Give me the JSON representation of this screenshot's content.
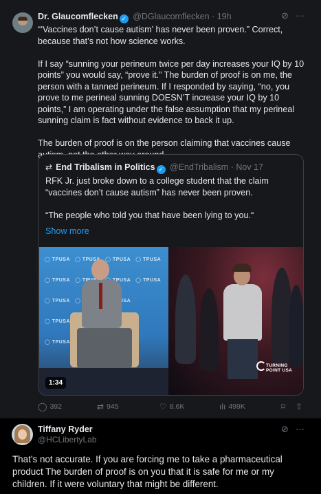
{
  "tweet": {
    "author_name": "Dr. Glaucomflecken",
    "author_handle": "@DGlaucomflecken",
    "time": "19h",
    "text": "“‘Vaccines don’t cause autism’ has never been proven.” Correct, because that’s not how science works.\n\nIf I say “sunning your perineum twice per day increases your IQ by 10 points” you would say, “prove it.” The burden of proof is on me, the person with a tanned perineum. If I responded by saying, “no, you prove to me perineal sunning DOESN’T increase your IQ by 10 points,” I am operating under the false assumption that my perineal sunning claim is fact without evidence to back it up.\n\nThe burden of proof is on the person claiming that vaccines cause autism, not the other way around.",
    "quoted": {
      "author_name": "End Tribalism in Politics",
      "author_handle": "@EndTribalism",
      "date": "Nov 17",
      "text": "RFK Jr. just broke down to a college student that the claim “vaccines don’t cause autism” has never been proven.\n\n“The people who told you that have been lying to you.“\n…",
      "show_more": "Show more",
      "video_duration": "1:34",
      "watermark": "TURNING POINT USA"
    },
    "stats": {
      "replies": "392",
      "reposts": "945",
      "likes": "8.6K",
      "views": "499K"
    }
  },
  "reply": {
    "author_name": "Tiffany Ryder",
    "author_handle": "@HCLibertyLab",
    "text": "That’s not accurate. If you are forcing me to take a pharmaceutical product The burden of proof is on you that it is safe for me or my children. If it were voluntary that might be different."
  },
  "icons": {
    "verified": "verified-badge-icon",
    "grok": "grok-icon",
    "more": "more-icon",
    "reply": "reply-icon",
    "repost": "repost-icon",
    "like": "like-icon",
    "views": "views-icon",
    "bookmark": "bookmark-icon",
    "share": "share-icon"
  },
  "colors": {
    "accent": "#1d9bf0",
    "text": "#e7e9ea",
    "muted": "#71767b",
    "card_bg": "#16181c"
  }
}
